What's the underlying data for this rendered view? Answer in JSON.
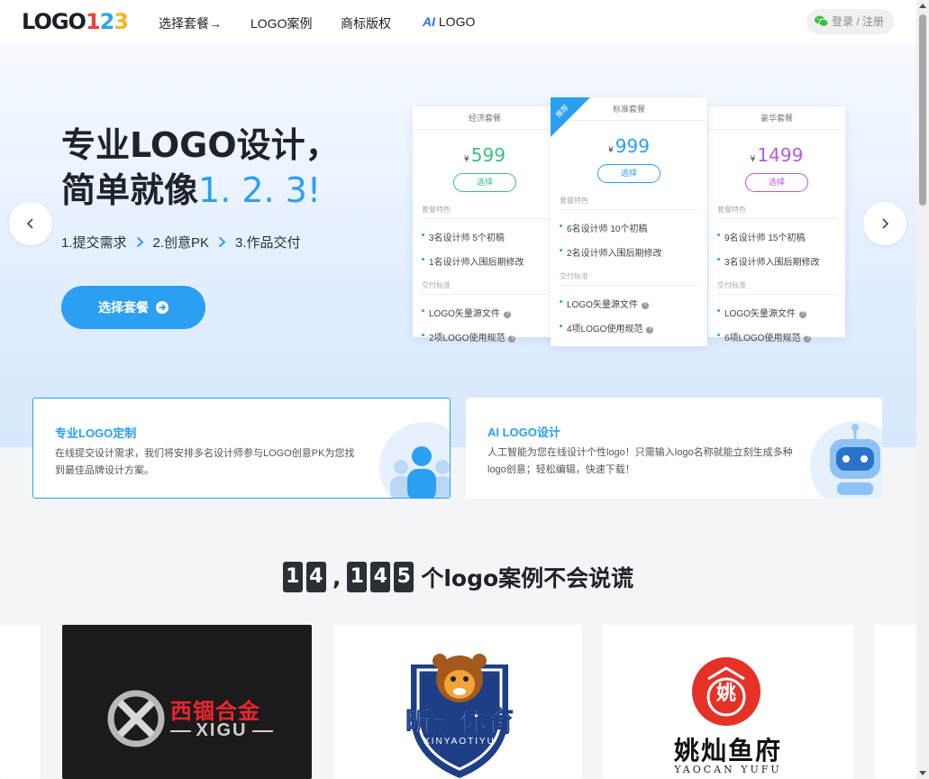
{
  "header": {
    "logo": {
      "text": "LOGO",
      "n1": "1",
      "n2": "2",
      "n3": "3"
    },
    "nav": [
      {
        "label": "选择套餐→"
      },
      {
        "label": "LOGO案例"
      },
      {
        "label": "商标版权"
      },
      {
        "label": "LOGO",
        "prefix": "AI"
      }
    ],
    "login_label": "登录 / 注册"
  },
  "hero": {
    "title_line1": "专业LOGO设计，",
    "title_line2_prefix": "简单就像",
    "title_line2_accent": "1. 2. 3!",
    "steps": [
      "1.提交需求",
      "2.创意PK",
      "3.作品交付"
    ],
    "cta_label": "选择套餐"
  },
  "plans": [
    {
      "name": "经济套餐",
      "currency": "¥",
      "price": "599",
      "select_label": "选择",
      "color": "#3bbf7a",
      "features_title": "套餐特色",
      "features": [
        "3名设计师 5个初稿",
        "1名设计师入围后期修改"
      ],
      "delivery_title": "交付标准",
      "delivery": [
        "LOGO矢量源文件",
        "2项LOGO使用规范"
      ]
    },
    {
      "name": "标准套餐",
      "badge": "推荐",
      "currency": "¥",
      "price": "999",
      "select_label": "选择",
      "color": "#2b9ff2",
      "features_title": "套餐特色",
      "features": [
        "6名设计师 10个初稿",
        "2名设计师入围后期修改"
      ],
      "delivery_title": "交付标准",
      "delivery": [
        "LOGO矢量源文件",
        "4项LOGO使用规范"
      ]
    },
    {
      "name": "豪华套餐",
      "currency": "¥",
      "price": "1499",
      "select_label": "选择",
      "color": "#b45ae0",
      "features_title": "套餐特色",
      "features": [
        "9名设计师 15个初稿",
        "3名设计师入围后期修改"
      ],
      "delivery_title": "交付标准",
      "delivery": [
        "LOGO矢量源文件",
        "6项LOGO使用规范"
      ]
    }
  ],
  "features": [
    {
      "title": "专业LOGO定制",
      "desc": "在线提交设计需求，我们将安排多名设计师参与LOGO创意PK为您找到最佳品牌设计方案。"
    },
    {
      "title": "AI LOGO设计",
      "desc": "人工智能为您在线设计个性logo！只需输入logo名称就能立刻生成多种logo创意；轻松编辑，快速下载！"
    }
  ],
  "counter": {
    "digits_a": [
      "1",
      "4"
    ],
    "separator": ",",
    "digits_b": [
      "1",
      "4",
      "5"
    ],
    "suffix": "个logo案例不会说谎"
  },
  "cases": [
    {
      "name": "西锢合金",
      "sub": "XIGU"
    },
    {
      "name": "昕耀体育",
      "sub": "XINYAOTIYU"
    },
    {
      "name": "姚灿鱼府",
      "sub": "YAOCAN YUFU",
      "seal": "姚"
    }
  ],
  "colors": {
    "accent": "#2b9ff2",
    "dark": "#1f2329",
    "green": "#3bbf7a",
    "purple": "#b45ae0"
  }
}
